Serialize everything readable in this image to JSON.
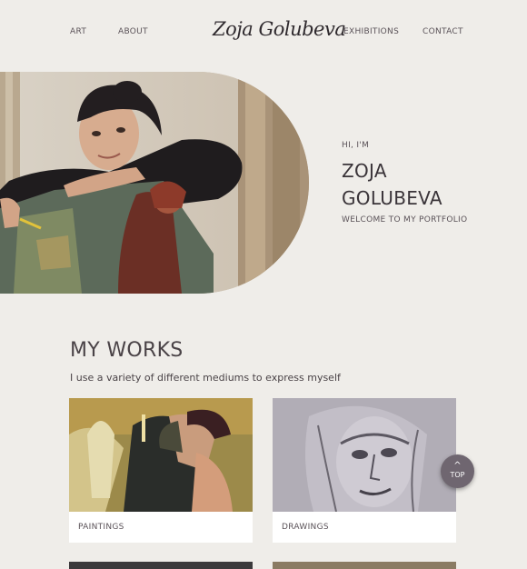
{
  "nav": {
    "art": "ART",
    "about": "ABOUT",
    "logo": "Zoja Golubeva",
    "exhibitions": "EXHIBITIONS",
    "contact": "CONTACT"
  },
  "hero": {
    "greeting": "HI, I'M",
    "first_name": "ZOJA",
    "last_name": "GOLUBEVA",
    "welcome": "WELCOME TO MY PORTFOLIO"
  },
  "works": {
    "title": "MY WORKS",
    "subtitle": "I use a variety of different mediums to express myself",
    "cards": [
      {
        "label": "PAINTINGS"
      },
      {
        "label": "DRAWINGS"
      }
    ]
  },
  "top_button": {
    "label": "TOP",
    "icon": "chevron-up-icon"
  },
  "colors": {
    "background": "#efede9",
    "text": "#4a4347",
    "button": "#6f6670"
  }
}
